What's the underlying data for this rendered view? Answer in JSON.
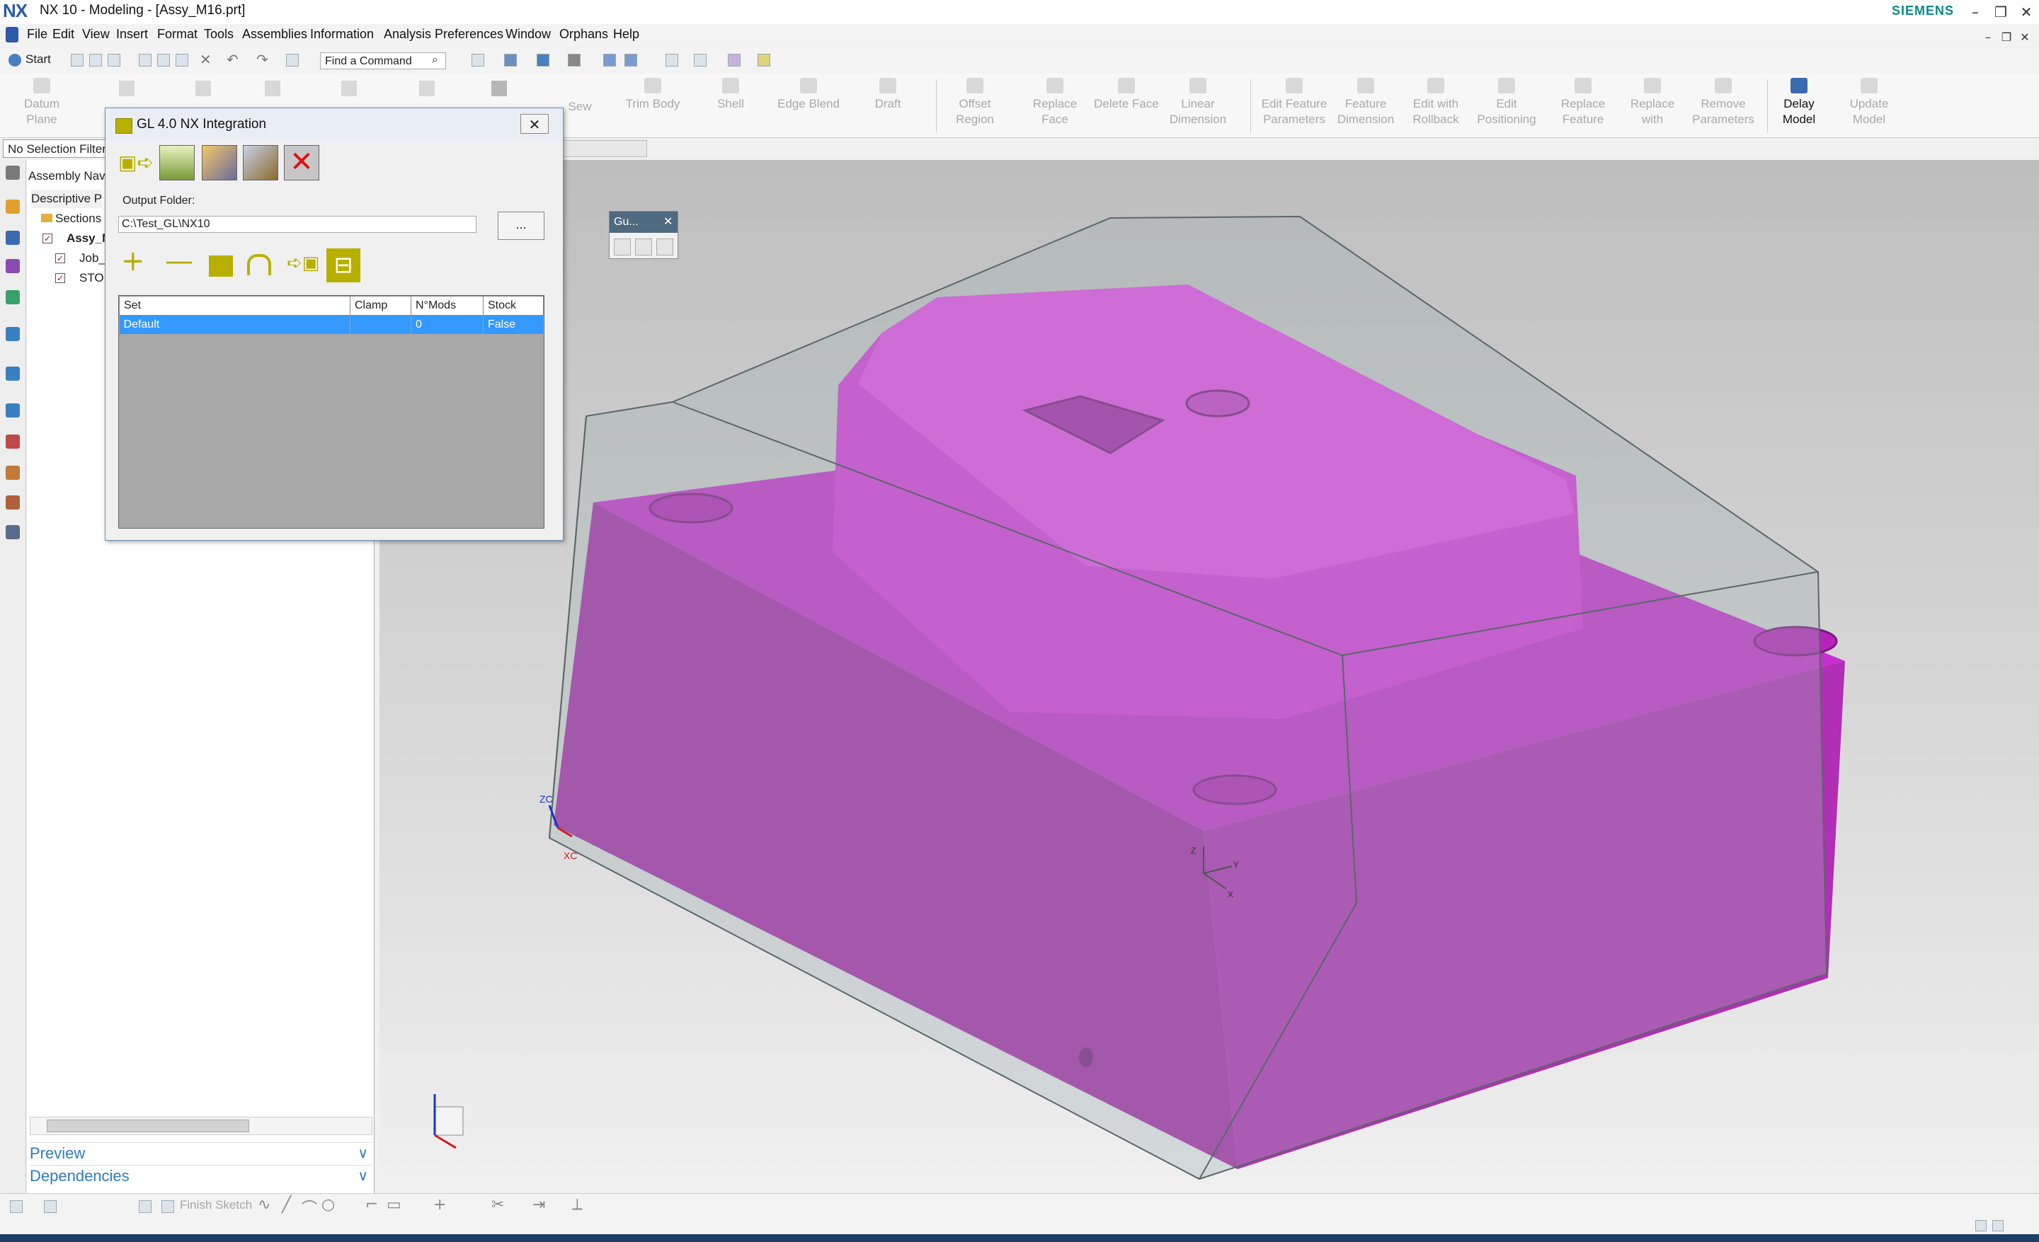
{
  "app": {
    "logo": "NX",
    "window_title": "NX 10 - Modeling - [Assy_M16.prt]",
    "brand": "SIEMENS"
  },
  "menu": [
    "File",
    "Edit",
    "View",
    "Insert",
    "Format",
    "Tools",
    "Assemblies",
    "Information",
    "Analysis",
    "Preferences",
    "Window",
    "Orphans",
    "Help"
  ],
  "quick": {
    "start_label": "Start",
    "find_placeholder": "Find a Command"
  },
  "ribbon": [
    {
      "l1": "Datum",
      "l2": "Plane",
      "on": false
    },
    {
      "l1": "Sew",
      "l2": "",
      "on": false
    },
    {
      "l1": "Trim Body",
      "l2": "",
      "on": false
    },
    {
      "l1": "Shell",
      "l2": "",
      "on": false
    },
    {
      "l1": "Edge Blend",
      "l2": "",
      "on": false
    },
    {
      "l1": "Draft",
      "l2": "",
      "on": false
    },
    {
      "l1": "Offset",
      "l2": "Region",
      "on": false
    },
    {
      "l1": "Replace",
      "l2": "Face",
      "on": false
    },
    {
      "l1": "Delete Face",
      "l2": "",
      "on": false
    },
    {
      "l1": "Linear",
      "l2": "Dimension",
      "on": false
    },
    {
      "l1": "Edit Feature",
      "l2": "Parameters",
      "on": false
    },
    {
      "l1": "Feature",
      "l2": "Dimension",
      "on": false
    },
    {
      "l1": "Edit with",
      "l2": "Rollback",
      "on": false
    },
    {
      "l1": "Edit",
      "l2": "Positioning",
      "on": false
    },
    {
      "l1": "Replace",
      "l2": "Feature",
      "on": false
    },
    {
      "l1": "Replace",
      "l2": "with",
      "on": false
    },
    {
      "l1": "Remove",
      "l2": "Parameters",
      "on": false
    },
    {
      "l1": "Delay",
      "l2": "Model",
      "on": true
    },
    {
      "l1": "Update",
      "l2": "Model",
      "on": false
    }
  ],
  "selection_filter": "No Selection Filter",
  "navigator": {
    "header": "Assembly Nav",
    "column": "Descriptive P",
    "rows": [
      "Sections",
      "Assy_M",
      "Job_",
      "STO"
    ],
    "preview": "Preview",
    "dependencies": "Dependencies"
  },
  "dialog": {
    "title": "GL 4.0 NX Integration",
    "output_label": "Output Folder:",
    "output_path": "C:\\Test_GL\\NX10",
    "browse_label": "...",
    "columns": [
      "Set",
      "Clamp",
      "N°Mods",
      "Stock"
    ],
    "rows": [
      {
        "set": "Default",
        "clamp": "",
        "mods": "0",
        "stock": "False"
      }
    ]
  },
  "mini_panel": {
    "title": "Gu..."
  },
  "axis_labels": {
    "zc": "ZC",
    "xc": "XC",
    "z": "Z",
    "y": "Y",
    "x": "X"
  },
  "sketch_toolbar": {
    "finish_sketch": "Finish Sketch"
  },
  "colors": {
    "part_magenta": "#c42bcb",
    "part_top": "#e64ae8",
    "stock_gray": "#a9b6b8",
    "selection_blue": "#3399ff",
    "accent_olive": "#b7b000"
  }
}
